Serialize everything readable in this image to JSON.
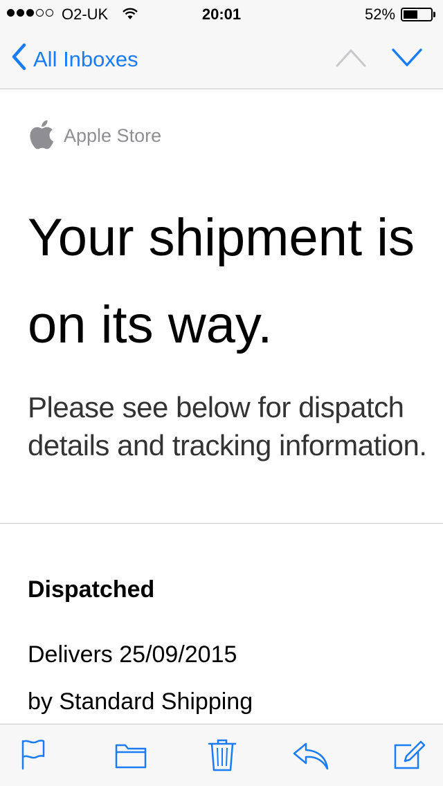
{
  "status_bar": {
    "carrier": "O2-UK",
    "signal_bars_filled": 3,
    "signal_bars_total": 5,
    "time": "20:01",
    "battery_percent": "52%",
    "battery_level": 0.52
  },
  "nav": {
    "back_label": "All Inboxes",
    "accent_color": "#1a7cf5",
    "prev_icon": "chevron-up-icon",
    "next_icon": "chevron-down-icon"
  },
  "email": {
    "sender": "Apple Store",
    "headline": "Your shipment is on its way.",
    "subtext": "Please see below for dispatch details and tracking information.",
    "status_heading": "Dispatched",
    "delivers": "Delivers 25/09/2015",
    "shipping": "by Standard Shipping"
  },
  "toolbar": {
    "icons": [
      "flag-icon",
      "folder-icon",
      "trash-icon",
      "reply-icon",
      "compose-icon"
    ]
  }
}
